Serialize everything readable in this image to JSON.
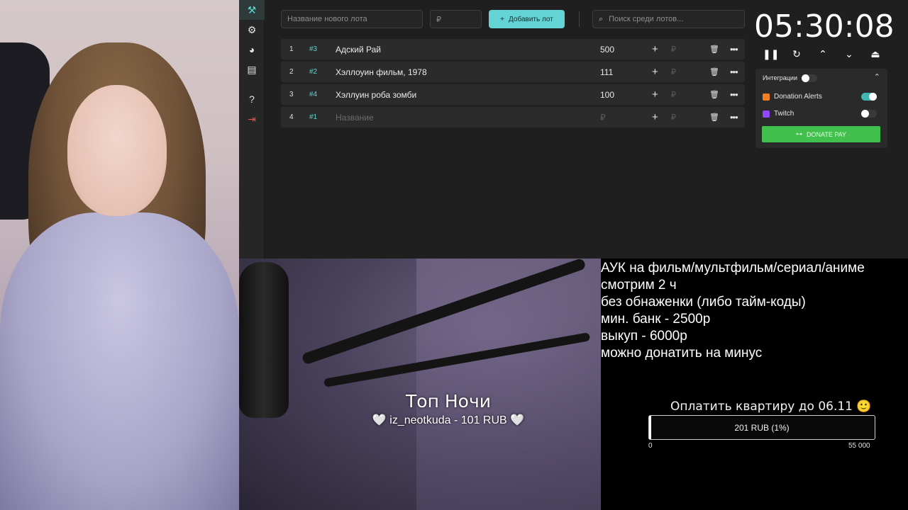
{
  "sidebar": {
    "items": [
      {
        "icon": "gavel-icon"
      },
      {
        "icon": "gear-icon"
      },
      {
        "icon": "pie-chart-icon"
      },
      {
        "icon": "clipboard-icon"
      },
      {
        "icon": "help-icon"
      },
      {
        "icon": "logout-icon"
      }
    ]
  },
  "toolbar": {
    "new_lot_placeholder": "Название нового лота",
    "price_placeholder": "₽",
    "add_button_label": "Добавить лот",
    "search_placeholder": "Поиск среди лотов..."
  },
  "lots": [
    {
      "num": "1",
      "tag": "#3",
      "title": "Адский Рай",
      "amount": "500",
      "currency": "₽"
    },
    {
      "num": "2",
      "tag": "#2",
      "title": "Хэллоуин фильм, 1978",
      "amount": "111",
      "currency": "₽"
    },
    {
      "num": "3",
      "tag": "#4",
      "title": "Хэллуин роба зомби",
      "amount": "100",
      "currency": "₽"
    },
    {
      "num": "4",
      "tag": "#1",
      "title": "Название",
      "amount": "₽",
      "currency": "₽"
    }
  ],
  "timer": {
    "value": "05:30:08"
  },
  "integrations": {
    "header": "Интеграции",
    "header_toggle": false,
    "items": [
      {
        "name": "Donation Alerts",
        "enabled": true,
        "color": "#f57f20"
      },
      {
        "name": "Twitch",
        "enabled": false,
        "color": "#9146ff"
      }
    ],
    "donate_pay_label": "DONATE PAY"
  },
  "info": {
    "lines": [
      "АУК на фильм/мультфильм/сериал/аниме",
      "смотрим 2 ч",
      "без обнаженки (либо тайм-коды)",
      "мин. банк - 2500р",
      "выкуп - 6000р",
      "можно донатить на минус"
    ]
  },
  "goal": {
    "title": "Оплатить квартиру до 06.11 🙂",
    "label": "201 RUB (1%)",
    "progress": 0.01,
    "min": "0",
    "max": "55 000"
  },
  "top_night": {
    "title": "Топ Ночи",
    "entry": "🤍 iz_neotkuda - 101 RUB 🤍"
  }
}
